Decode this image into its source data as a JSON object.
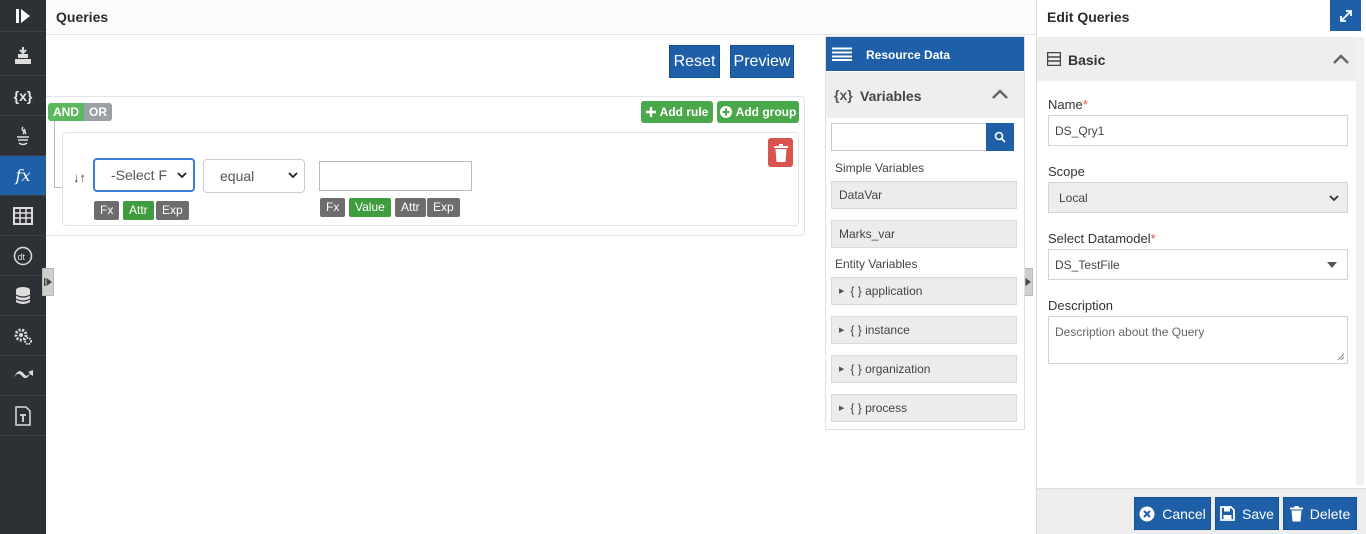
{
  "queries": {
    "title": "Queries",
    "reset_label": "Reset",
    "preview_label": "Preview",
    "builder": {
      "and_label": "AND",
      "or_label": "OR",
      "add_rule_label": "Add rule",
      "add_group_label": "Add group",
      "field_select_value": "-Select F",
      "operator_value": "equal",
      "left_tags": [
        "Fx",
        "Attr",
        "Exp"
      ],
      "right_tags": [
        "Fx",
        "Value",
        "Attr",
        "Exp"
      ]
    }
  },
  "resource": {
    "title": "Resource Data",
    "variables_title": "Variables",
    "fx_glyph": "{x}",
    "simple_label": "Simple Variables",
    "simple_vars": [
      "DataVar",
      "Marks_var"
    ],
    "entity_label": "Entity Variables",
    "entity_vars": [
      "{ } application",
      "{ } instance",
      "{ } organization",
      "{ } process"
    ]
  },
  "edit": {
    "title": "Edit Queries",
    "section_title": "Basic",
    "name_label": "Name",
    "name_value": "DS_Qry1",
    "scope_label": "Scope",
    "scope_value": "Local",
    "datamodel_label": "Select Datamodel",
    "datamodel_value": "DS_TestFile",
    "description_label": "Description",
    "description_placeholder": "Description about the Query",
    "required_mark": "*",
    "cancel_label": "Cancel",
    "save_label": "Save",
    "delete_label": "Delete"
  },
  "rail": {
    "fx_glyph": "fx",
    "var_glyph": "{x}"
  },
  "colors": {
    "primary": "#1f5fa8",
    "success": "#4aa84a",
    "danger": "#d9534f",
    "rail": "#2d3035"
  }
}
